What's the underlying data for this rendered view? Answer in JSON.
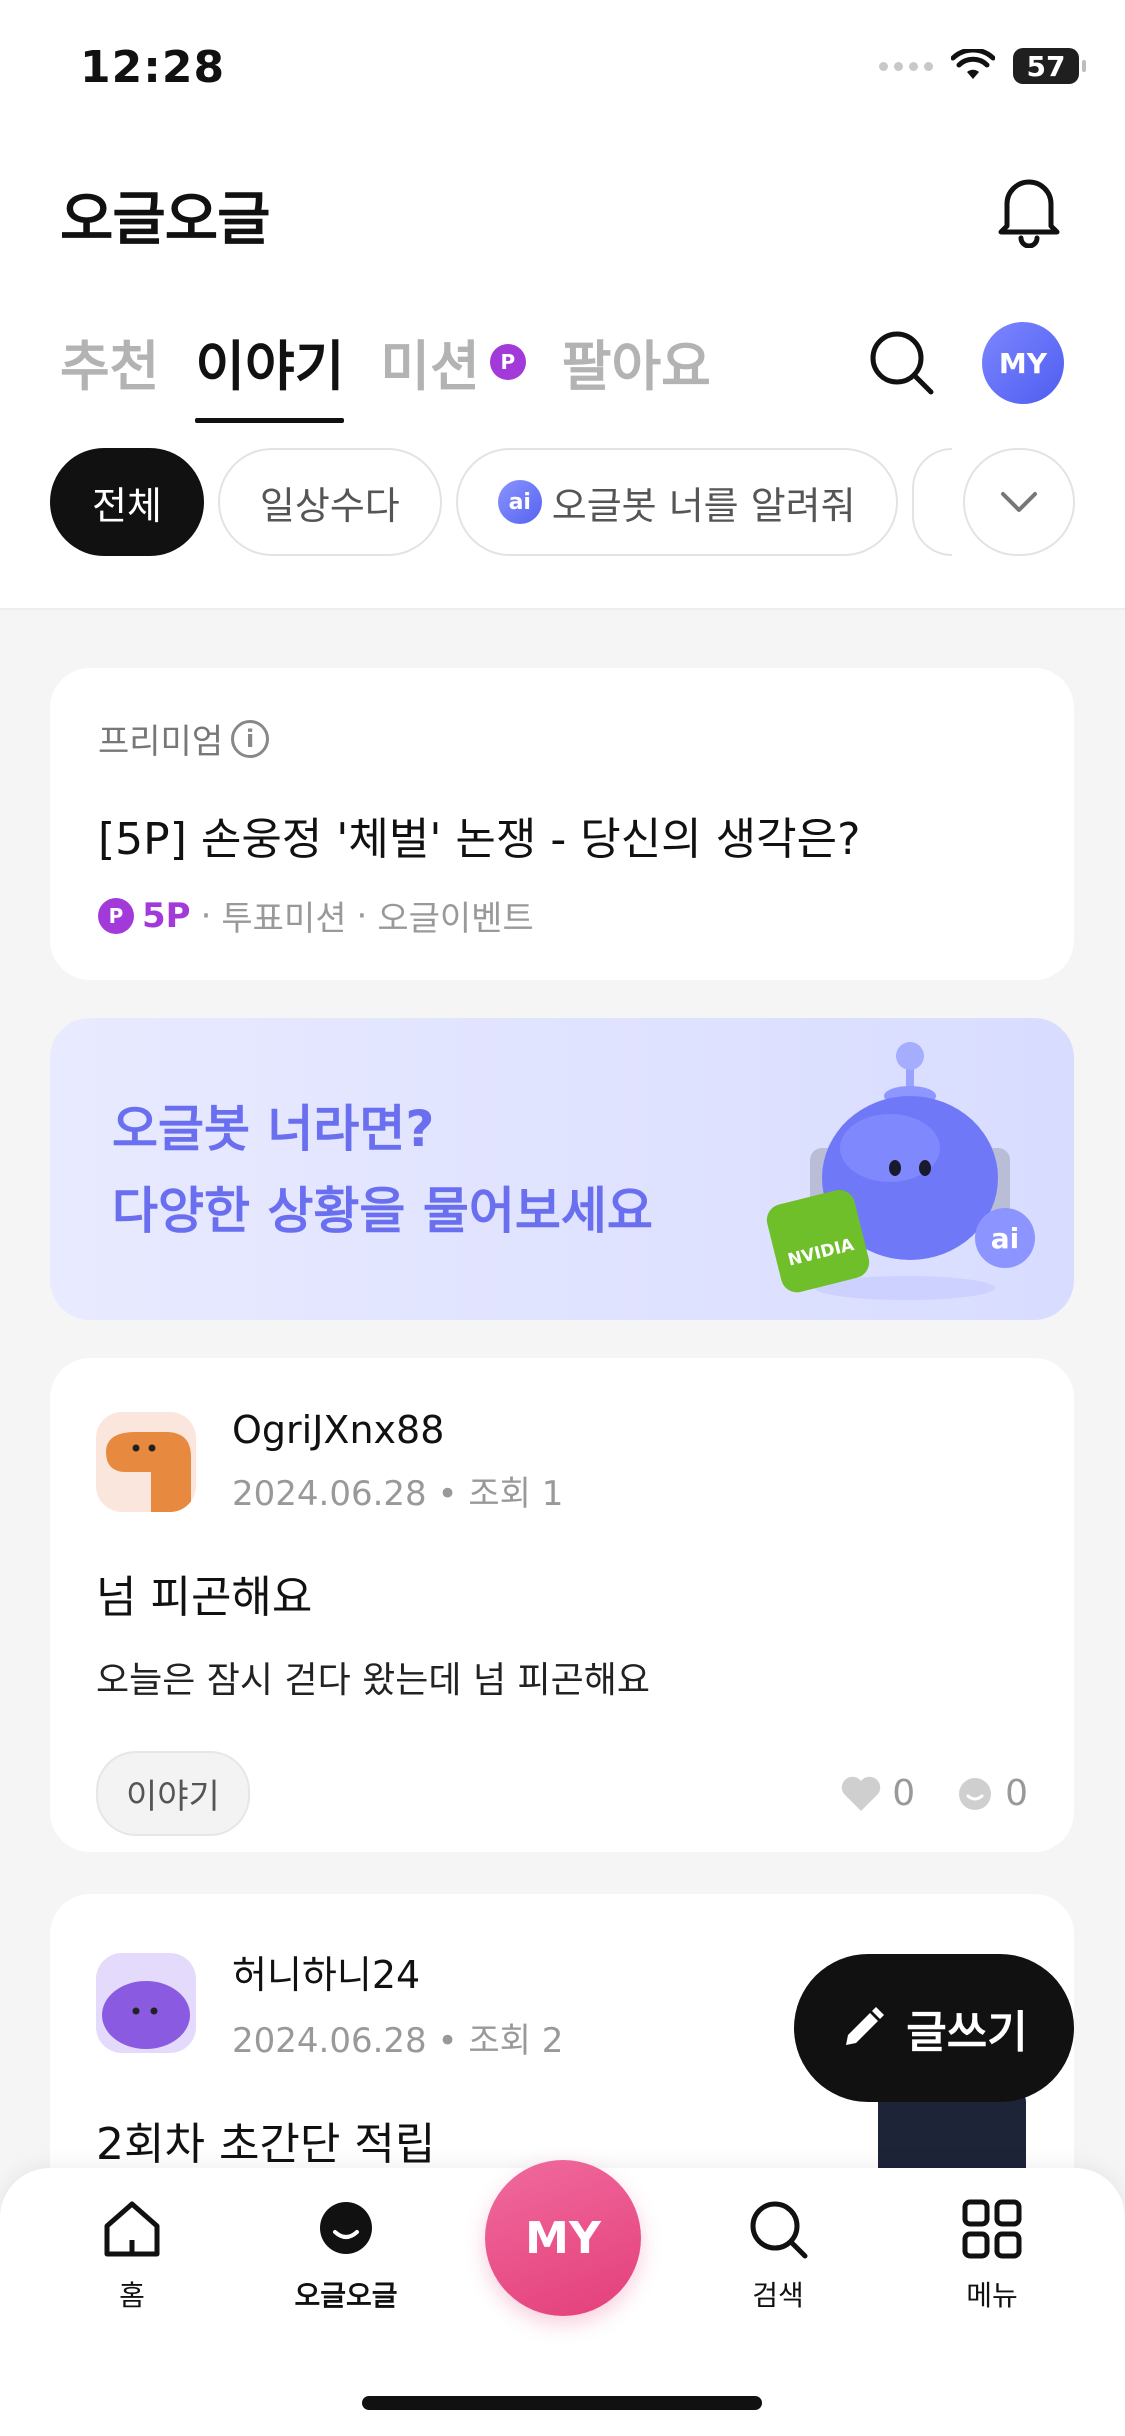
{
  "status": {
    "time": "12:28",
    "battery": "57"
  },
  "header": {
    "title": "오글오글"
  },
  "tabs": [
    {
      "label": "추천"
    },
    {
      "label": "이야기"
    },
    {
      "label": "미션",
      "badge": "P"
    },
    {
      "label": "팔아요"
    }
  ],
  "profile": {
    "label": "MY"
  },
  "chips": [
    {
      "label": "전체"
    },
    {
      "label": "일상수다"
    },
    {
      "label": "오글봇 너를 알려줘",
      "icon": "ai"
    }
  ],
  "premium": {
    "label": "프리미엄",
    "title": "[5P] 손웅정 '체벌' 논쟁 - 당신의 생각은?",
    "points": "5P",
    "meta1": "투표미션",
    "meta2": "오글이벤트"
  },
  "banner": {
    "line1": "오글봇 너라면?",
    "line2": "다양한 상황을 물어보세요",
    "badge_text": "NVIDIA",
    "ai_badge": "ai"
  },
  "posts": [
    {
      "author": "OgriJXnx88",
      "meta": "2024.06.28 • 조회 1",
      "title": "넘 피곤해요",
      "body": "오늘은 잠시 걷다 왔는데 넘 피곤해요",
      "tag": "이야기",
      "likes": "0",
      "comments": "0"
    },
    {
      "author": "허니하니24",
      "meta": "2024.06.28 • 조회 2",
      "title": "2회차 초간단 적립"
    }
  ],
  "write_button": {
    "label": "글쓰기"
  },
  "bottom_nav": [
    {
      "label": "홈"
    },
    {
      "label": "오글오글"
    },
    {
      "label": "MY"
    },
    {
      "label": "검색"
    },
    {
      "label": "메뉴"
    }
  ],
  "colors": {
    "accent_purple": "#a13ad8",
    "my_pink": "#e43f79",
    "banner_text": "#6a6ff0"
  }
}
